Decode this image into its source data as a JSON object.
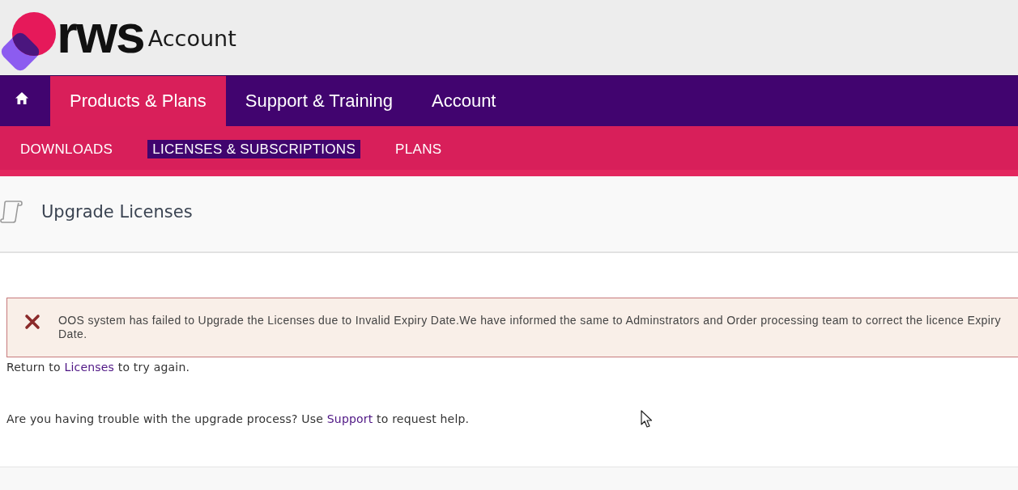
{
  "header": {
    "logo_text": "rws",
    "title": "Account"
  },
  "main_nav": [
    {
      "kind": "home",
      "selected": false
    },
    {
      "kind": "link",
      "label": "Products & Plans",
      "selected": true
    },
    {
      "kind": "link",
      "label": "Support & Training",
      "selected": false
    },
    {
      "kind": "link",
      "label": "Account",
      "selected": false
    }
  ],
  "sub_nav": [
    {
      "label": "DOWNLOADS",
      "selected": false
    },
    {
      "label": "LICENSES & SUBSCRIPTIONS",
      "selected": true
    },
    {
      "label": "PLANS",
      "selected": false
    }
  ],
  "page_header": {
    "title": "Upgrade Licenses"
  },
  "alert": {
    "kind": "error",
    "message": "OOS system has failed to Upgrade the Licenses due to Invalid Expiry Date.We have informed the same to Adminstrators and Order processing team to correct the licence Expiry Date."
  },
  "paragraphs": [
    {
      "before": "Return to ",
      "link": "Licenses",
      "after": " to try again."
    },
    {
      "before": "Are you having trouble with the upgrade process? Use ",
      "link": "Support",
      "after": " to request help."
    }
  ]
}
